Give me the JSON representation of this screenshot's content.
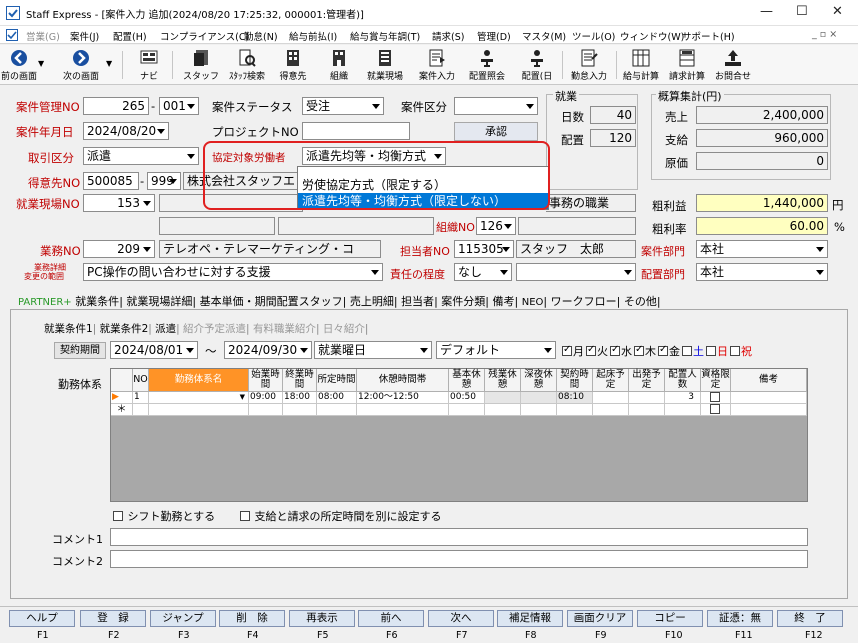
{
  "window": {
    "title": "Staff Express - [案件入力 追加(2024/08/20 17:25:32, 000001:管理者)]"
  },
  "menu": [
    "営業(G)",
    "案件(J)",
    "配置(H)",
    "コンプライアンス(C)",
    "勤怠(N)",
    "給与前払(I)",
    "給与賞与年調(T)",
    "請求(S)",
    "管理(D)",
    "マスタ(M)",
    "ツール(O)",
    "ウィンドウ(W)",
    "サポート(H)"
  ],
  "toolbar": [
    "前の画面",
    "次の画面",
    "ナビ",
    "スタッフ",
    "ｽﾀｯﾌ検索",
    "得意先",
    "組織",
    "就業現場",
    "案件入力",
    "配置照会",
    "配置(日",
    "勤怠入力",
    "給与計算",
    "請求計算",
    "お問合せ"
  ],
  "form": {
    "anken_kanri_no_label": "案件管理NO",
    "anken_kanri_no": "265",
    "anken_kanri_sub": "001",
    "anken_status_label": "案件ステータス",
    "anken_status": "受注",
    "anken_kubun_label": "案件区分",
    "anken_kubun": "",
    "anken_date_label": "案件年月日",
    "anken_date": "2024/08/20",
    "project_no_label": "プロジェクトNO",
    "project_no": "",
    "approve_button": "承認",
    "torihiki_label": "取引区分",
    "torihiki": "派遣",
    "kyotei_label": "協定対象労働者",
    "kyotei": "派遣先均等・均衡方式",
    "tokuisaki_label": "得意先NO",
    "tokuisaki_no": "500085",
    "tokuisaki_sub": "999",
    "tokuisaki_name": "株式会社スタッフエ",
    "genba_label": "就業現場NO",
    "genba_no": "153",
    "genba_name": "事務の職業",
    "soshiki_label": "組織NO",
    "soshiki_no": "126",
    "gyomu_label": "業務NO",
    "gyomu_no": "209",
    "gyomu_name": "テレオペ・テレマーケティング・コ",
    "tanto_label": "担当者NO",
    "tanto_no": "115305",
    "tanto_name": "スタッフ　太郎",
    "gyomu_detail_label_1": "業務詳細",
    "gyomu_detail_label_2": "変更の範囲",
    "gyomu_detail": "PC操作の問い合わせに対する支援",
    "sekinin_label": "責任の程度",
    "sekinin": "なし",
    "sekinin_2": "",
    "anken_bumon_label": "案件部門",
    "anken_bumon": "本社",
    "haichi_bumon_label": "配置部門",
    "haichi_bumon": "本社"
  },
  "dropdown": {
    "options": [
      "労使協定方式（限定する）",
      "派遣先均等・均衡方式（限定しない）"
    ]
  },
  "shugyo": {
    "title": "就業",
    "nissu_label": "日数",
    "nissu": "40",
    "haichi_label": "配置",
    "haichi": "120"
  },
  "gaisan": {
    "title": "概算集計(円)",
    "uriage_label": "売上",
    "uriage": "2,400,000",
    "shikyu_label": "支給",
    "shikyu": "960,000",
    "genka_label": "原価",
    "genka": "0",
    "arari_label": "粗利益",
    "arari": "1,440,000",
    "arari_unit": "円",
    "ararirate_label": "粗利率",
    "ararirate": "60.00",
    "ararirate_unit": "%"
  },
  "tabs": [
    "PARTNER+",
    "就業条件",
    "就業現場詳細",
    "基本単価・期間配置スタッフ",
    "売上明細",
    "担当者",
    "案件分類",
    "備考",
    "NEO",
    "ワークフロー",
    "その他"
  ],
  "subtabs": [
    "就業条件1",
    "就業条件2",
    "派遣",
    "紹介予定派遣",
    "有料職業紹介",
    "日々紹介"
  ],
  "period": {
    "button": "契約期間",
    "from": "2024/08/01",
    "tilde": "～",
    "to": "2024/09/30",
    "kind": "就業曜日",
    "pattern": "デフォルト",
    "days": [
      {
        "d": "月",
        "c": true
      },
      {
        "d": "火",
        "c": true
      },
      {
        "d": "水",
        "c": true
      },
      {
        "d": "木",
        "c": true
      },
      {
        "d": "金",
        "c": true
      },
      {
        "d": "土",
        "c": false
      },
      {
        "d": "日",
        "c": false
      },
      {
        "d": "祝",
        "c": false
      }
    ]
  },
  "kinmu_label": "勤務体系",
  "grid": {
    "headers": [
      "NO",
      "勤務体系名",
      "始業時間",
      "終業時間",
      "所定時間",
      "休憩時間帯",
      "基本休憩",
      "残業休憩",
      "深夜休憩",
      "契約時間",
      "起床予定",
      "出発予定",
      "配置人数",
      "資格限定",
      "備考"
    ],
    "row": {
      "no": "1",
      "name": "",
      "start": "09:00",
      "end": "18:00",
      "shotei": "08:00",
      "kyukei": "12:00～12:50",
      "kihon": "00:50",
      "zangyo": "",
      "shinya": "",
      "keiyaku": "08:10",
      "kisho": "",
      "shuppatsu": "",
      "ninzu": "3",
      "shikaku": "",
      "biko": ""
    },
    "newrow": "＊"
  },
  "options": {
    "shift": "シフト勤務とする",
    "shotei_betsu": "支給と請求の所定時間を別に設定する"
  },
  "comment1_label": "コメント1",
  "comment2_label": "コメント2",
  "fkeys": [
    {
      "l": "ヘルプ",
      "k": "F1"
    },
    {
      "l": "登　録",
      "k": "F2"
    },
    {
      "l": "ジャンプ",
      "k": "F3"
    },
    {
      "l": "削　除",
      "k": "F4"
    },
    {
      "l": "再表示",
      "k": "F5"
    },
    {
      "l": "前へ",
      "k": "F6"
    },
    {
      "l": "次へ",
      "k": "F7"
    },
    {
      "l": "補足情報",
      "k": "F8"
    },
    {
      "l": "画面クリア",
      "k": "F9"
    },
    {
      "l": "コピー",
      "k": "F10"
    },
    {
      "l": "証憑：無",
      "k": "F11"
    },
    {
      "l": "終　了",
      "k": "F12"
    }
  ]
}
